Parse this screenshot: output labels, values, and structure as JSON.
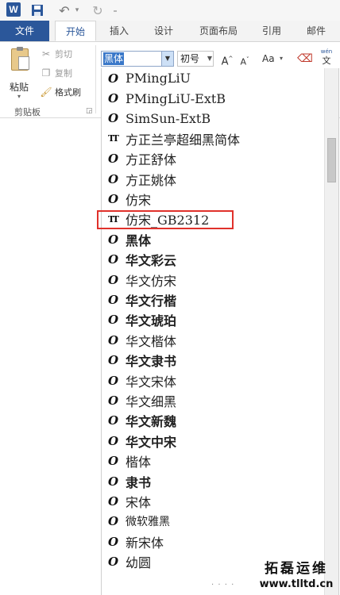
{
  "quick_access": {
    "app_icon": "word-icon",
    "app_letter": "W",
    "save_icon": "save-icon",
    "undo_icon": "undo-icon",
    "redo_icon": "redo-icon",
    "customize_icon": "chevron-down-icon"
  },
  "ribbon_tabs": [
    {
      "label": "文件"
    },
    {
      "label": "开始"
    },
    {
      "label": "插入"
    },
    {
      "label": "设计"
    },
    {
      "label": "页面布局"
    },
    {
      "label": "引用"
    },
    {
      "label": "邮件"
    }
  ],
  "clipboard_group": {
    "paste_label": "粘贴",
    "cut_label": "剪切",
    "copy_label": "复制",
    "format_painter_label": "格式刷",
    "group_label": "剪贴板"
  },
  "font_group": {
    "font_name": "黑体",
    "font_size": "初号",
    "grow_label": "A",
    "shrink_label": "A",
    "case_label": "Aa",
    "phonetic_top": "wén",
    "phonetic_bottom": "文"
  },
  "font_list": [
    {
      "name": "PMingLiU",
      "type": "opentype"
    },
    {
      "name": "PMingLiU-ExtB",
      "type": "opentype"
    },
    {
      "name": "SimSun-ExtB",
      "type": "opentype"
    },
    {
      "name": "方正兰亭超细黑简体",
      "type": "truetype"
    },
    {
      "name": "方正舒体",
      "type": "opentype"
    },
    {
      "name": "方正姚体",
      "type": "opentype"
    },
    {
      "name": "仿宋",
      "type": "opentype"
    },
    {
      "name": "仿宋_GB2312",
      "type": "truetype",
      "highlighted": true
    },
    {
      "name": "黑体",
      "type": "opentype"
    },
    {
      "name": "华文彩云",
      "type": "opentype"
    },
    {
      "name": "华文仿宋",
      "type": "opentype"
    },
    {
      "name": "华文行楷",
      "type": "opentype"
    },
    {
      "name": "华文琥珀",
      "type": "opentype"
    },
    {
      "name": "华文楷体",
      "type": "opentype"
    },
    {
      "name": "华文隶书",
      "type": "opentype"
    },
    {
      "name": "华文宋体",
      "type": "opentype"
    },
    {
      "name": "华文细黑",
      "type": "opentype"
    },
    {
      "name": "华文新魏",
      "type": "opentype"
    },
    {
      "name": "华文中宋",
      "type": "opentype"
    },
    {
      "name": "楷体",
      "type": "opentype"
    },
    {
      "name": "隶书",
      "type": "opentype"
    },
    {
      "name": "宋体",
      "type": "opentype"
    },
    {
      "name": "微软雅黑",
      "type": "opentype"
    },
    {
      "name": "新宋体",
      "type": "opentype"
    },
    {
      "name": "幼圆",
      "type": "opentype"
    }
  ],
  "watermark": {
    "cn": "拓磊运维",
    "en": "www.tlltd.cn"
  }
}
